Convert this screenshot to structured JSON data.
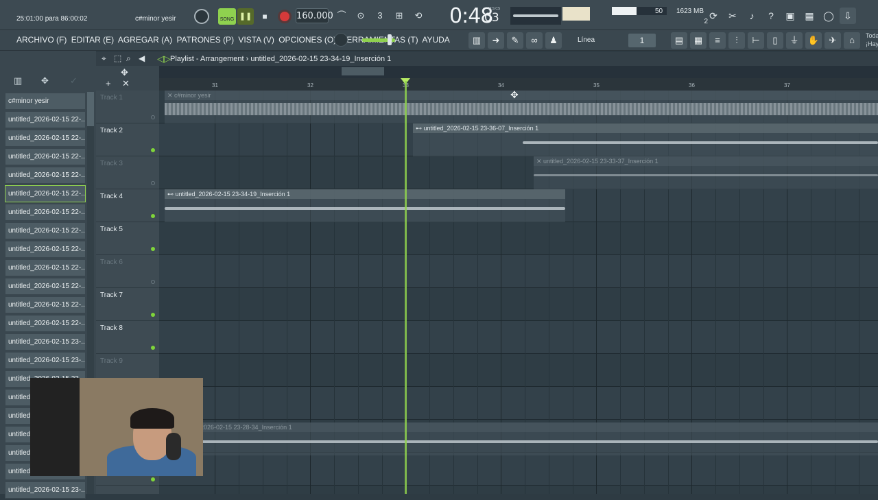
{
  "topbar": {
    "hint_label": "25:01:00 para 86:00:02",
    "song_name": "c#minor yesir",
    "song_mode_label": "SONG",
    "tempo": "160.000",
    "time_main": "0:48",
    "time_ms": "03",
    "time_unit": "M:S:CS",
    "cpu": "50",
    "memory": "1623 MB",
    "polyphony": "2"
  },
  "menu": {
    "items": [
      "ARCHIVO (F)",
      "EDITAR (E)",
      "AGREGAR (A)",
      "PATRONES (P)",
      "VISTA (V)",
      "OPCIONES (O)",
      "HERRAMIENTAS (T)",
      "AYUDA"
    ],
    "snap_label": "Línea",
    "pattern_number": "1",
    "today_text_1": "Toda",
    "today_text_2": "¡Hay"
  },
  "playlist": {
    "title": "Playlist - Arrangement",
    "separator": "›",
    "pattern_name": "untitled_2026-02-15 23-34-19_Inserción 1"
  },
  "ruler": {
    "bars": [
      "31",
      "32",
      "33",
      "34",
      "35",
      "36",
      "37"
    ]
  },
  "browser": {
    "patterns": [
      "c#minor yesir",
      "untitled_2026-02-15 22-...",
      "untitled_2026-02-15 22-...",
      "untitled_2026-02-15 22-...",
      "untitled_2026-02-15 22-...",
      "untitled_2026-02-15 22-...",
      "untitled_2026-02-15 22-...",
      "untitled_2026-02-15 22-...",
      "untitled_2026-02-15 22-...",
      "untitled_2026-02-15 22-...",
      "untitled_2026-02-15 22-...",
      "untitled_2026-02-15 22-...",
      "untitled_2026-02-15 22-...",
      "untitled_2026-02-15 23-...",
      "untitled_2026-02-15 23-...",
      "untitled_2026-02-15 23-...",
      "untitled",
      "untitled",
      "untitled",
      "untitled",
      "untitled",
      "untitled_2026-02-15 23-..."
    ]
  },
  "tracks": [
    {
      "name": "Track 1",
      "muted": true
    },
    {
      "name": "Track 2",
      "muted": false
    },
    {
      "name": "Track 3",
      "muted": true
    },
    {
      "name": "Track 4",
      "muted": false
    },
    {
      "name": "Track 5",
      "muted": false
    },
    {
      "name": "Track 6",
      "muted": true
    },
    {
      "name": "Track 7",
      "muted": false
    },
    {
      "name": "Track 8",
      "muted": false
    },
    {
      "name": "Track 9",
      "muted": true
    },
    {
      "name": "",
      "muted": false
    },
    {
      "name": "",
      "muted": false
    },
    {
      "name": "",
      "muted": false
    }
  ],
  "clips": {
    "track1": "c#minor yesir",
    "track2": "untitled_2026-02-15 23-36-07_Inserción 1",
    "track3": "untitled_2026-02-15 23-33-37_Inserción 1",
    "track4": "untitled_2026-02-15 23-34-19_Inserción 1",
    "track11": "2026-02-15 23-28-34_Inserción 1"
  },
  "colors": {
    "accent": "#8fd14f",
    "record": "#d63a3a"
  }
}
